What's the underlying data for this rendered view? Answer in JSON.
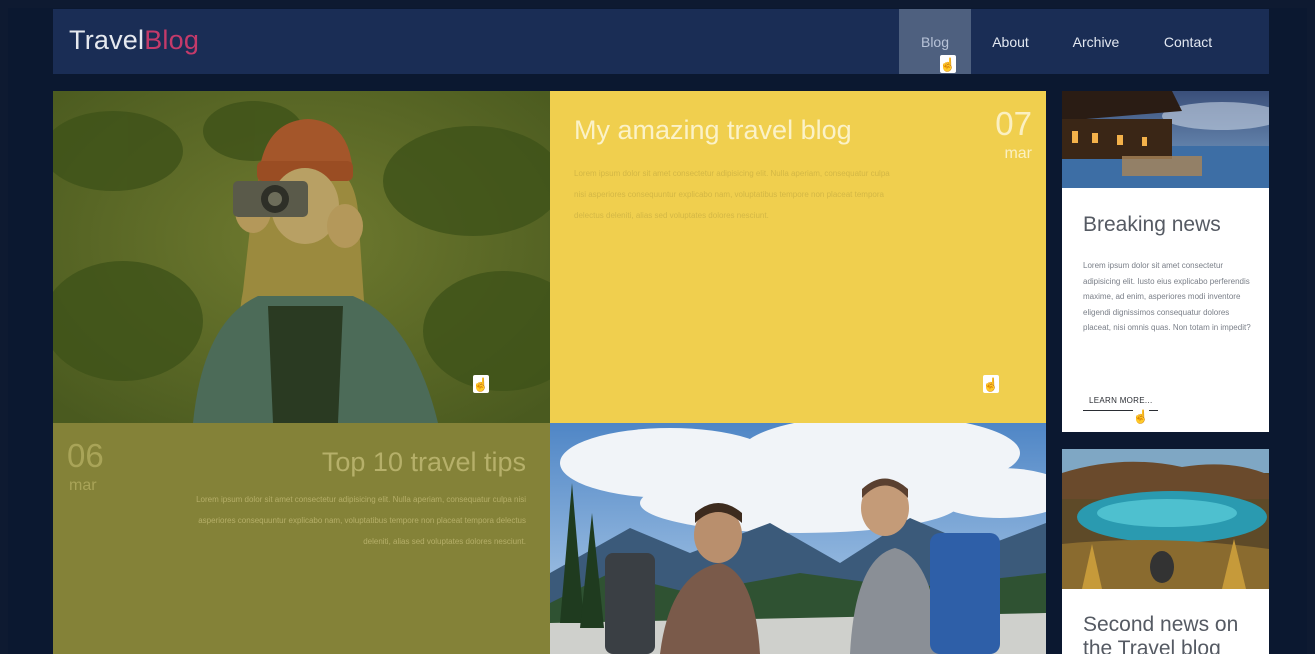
{
  "header": {
    "logo_part1": "Travel",
    "logo_part2": "Blog",
    "nav": [
      "Blog",
      "About",
      "Archive",
      "Contact"
    ],
    "active_nav": "Blog"
  },
  "posts": {
    "featured": {
      "title": "My amazing travel blog",
      "day": "07",
      "month": "mar",
      "text": "Lorem ipsum dolor sit amet consectetur adipisicing elit. Nulla aperiam, consequatur culpa nisi asperiores consequuntur explicabo nam, voluptatibus tempore non placeat tempora delectus deleniti, alias sed voluptates dolores nesciunt."
    },
    "second": {
      "title": "Top 10 travel tips",
      "day": "06",
      "month": "mar",
      "text": "Lorem ipsum dolor sit amet consectetur adipisicing elit. Nulla aperiam, consequatur culpa nisi asperiores consequuntur explicabo nam, voluptatibus tempore non placeat tempora delectus deleniti, alias sed voluptates dolores nesciunt."
    }
  },
  "sidebar": {
    "card1": {
      "title": "Breaking news",
      "text": "Lorem ipsum dolor sit amet consectetur adipisicing elit. Iusto eius explicabo perferendis maxime, ad enim, asperiores modi inventore eligendi dignissimos consequatur dolores placeat, nisi omnis quas. Non totam in impedit?",
      "button": "LEARN MORE..."
    },
    "card2": {
      "title": "Second news on the Travel blog"
    }
  },
  "colors": {
    "header_bg": "#1a2d55",
    "logo_accent": "#c43a6a",
    "featured_bg": "#f0cf4e",
    "second_bg": "#848238"
  },
  "icons": [
    "hand-pointer-icon"
  ]
}
